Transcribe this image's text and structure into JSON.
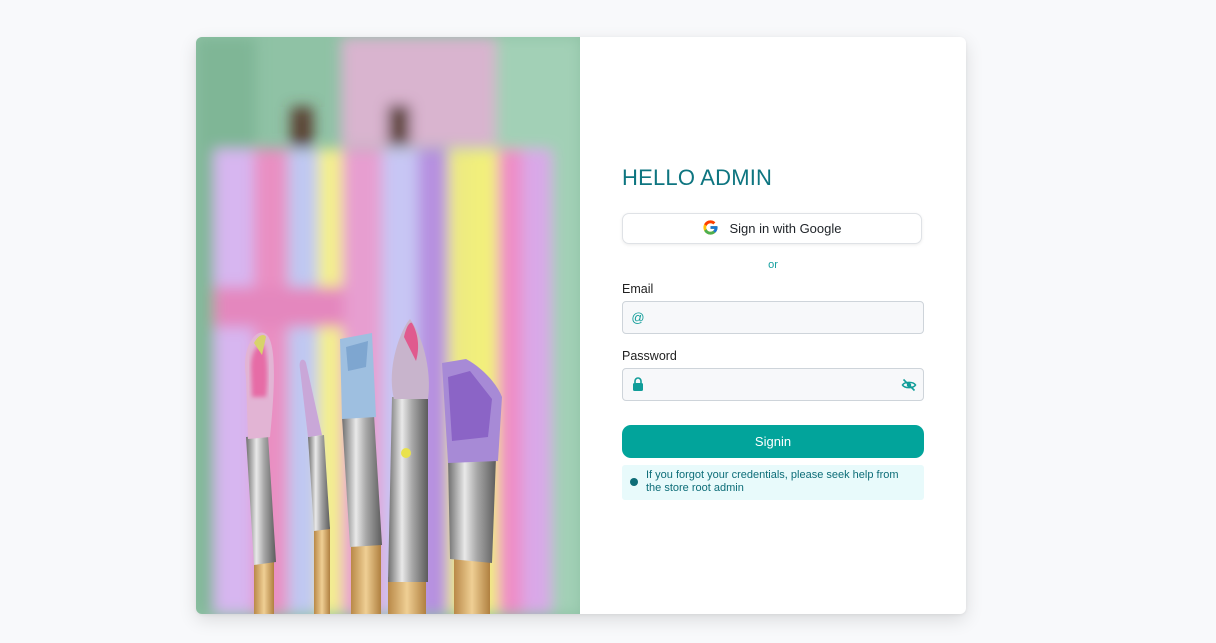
{
  "colors": {
    "page_bg": "#f8f9fb",
    "brand_teal": "#02a49b",
    "title_teal": "#0e7580",
    "note_bg": "#e8fafb"
  },
  "hero": {
    "image": "paintbrushes-in-front-of-abstract-painting"
  },
  "form": {
    "title": "HELLO ADMIN",
    "google_button": {
      "label": "Sign in with Google",
      "icon": "google-g-icon"
    },
    "divider": "or",
    "email": {
      "label": "Email",
      "value": "",
      "placeholder": "",
      "icon": "at-sign-icon"
    },
    "password": {
      "label": "Password",
      "value": "",
      "placeholder": "",
      "icon": "lock-icon",
      "toggle_icon": "eye-off-icon"
    },
    "submit_label": "Signin",
    "notice": {
      "icon": "info-dot-icon",
      "text": "If you forgot your credentials, please seek help from the store root admin"
    }
  }
}
